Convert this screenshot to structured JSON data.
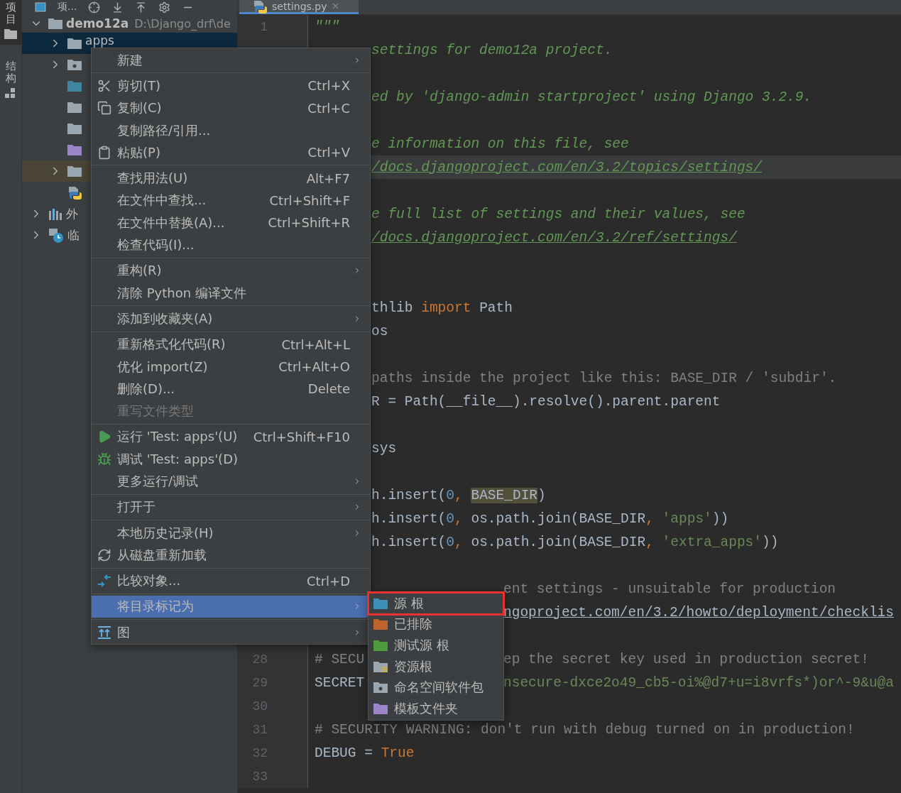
{
  "side_strip": {
    "tabs": [
      {
        "label": "项目",
        "selected": true
      },
      {
        "label": "结构",
        "selected": false
      }
    ]
  },
  "project_panel": {
    "toolbar": {
      "title": "项..."
    },
    "tree": [
      {
        "label": "demo12a",
        "path": "D:\\Django_drf\\de",
        "kind": "folder",
        "color": "#9aa7b0",
        "expanded": true,
        "selected": false,
        "highlighted": false,
        "children": [
          {
            "label": "apps",
            "kind": "folder",
            "color": "#9aa7b0",
            "expanded": false,
            "selected": true,
            "highlighted": false
          },
          {
            "kind": "namespace",
            "color": "#9aa7b0",
            "expanded": false,
            "selected": false,
            "highlighted": false
          },
          {
            "kind": "leaf_folder",
            "color": "#3e86a0",
            "selected": false,
            "highlighted": false
          },
          {
            "kind": "leaf_folder",
            "color": "#9aa7b0",
            "selected": false,
            "highlighted": false
          },
          {
            "kind": "leaf_folder",
            "color": "#9aa7b0",
            "selected": false,
            "highlighted": false
          },
          {
            "kind": "leaf_folder",
            "color": "#9b84c8",
            "selected": false,
            "highlighted": false
          },
          {
            "kind": "folder",
            "color": "#9aa7b0",
            "expanded": false,
            "selected": false,
            "highlighted": true
          },
          {
            "kind": "python_file",
            "selected": false,
            "highlighted": false
          }
        ]
      },
      {
        "label": "外",
        "kind": "library",
        "expanded": false,
        "selected": false,
        "highlighted": false
      },
      {
        "label": "临",
        "kind": "scratch",
        "expanded": false,
        "selected": false,
        "highlighted": false
      }
    ]
  },
  "editor": {
    "tab": {
      "label": "settings.py",
      "selected": true
    },
    "lines": [
      {
        "number": "1",
        "kind": "full",
        "parts": [
          {
            "text": "\"\"\"",
            "kind": "doc"
          }
        ]
      },
      {
        "kind": "after_menu",
        "parts": [
          {
            "text": "settings for demo12a project.",
            "kind": "doc"
          }
        ]
      },
      {
        "kind": "blank"
      },
      {
        "kind": "after_menu",
        "parts": [
          {
            "text": "ed by 'django-admin startproject' using Django 3.2.9.",
            "kind": "doc"
          }
        ]
      },
      {
        "kind": "blank"
      },
      {
        "kind": "after_menu",
        "parts": [
          {
            "text": "e information on this file, see",
            "kind": "doc"
          }
        ]
      },
      {
        "kind": "after_menu",
        "current": true,
        "parts": [
          {
            "text": "/docs.djangoproject.com/en/3.2/topics/settings/",
            "kind": "link"
          }
        ]
      },
      {
        "kind": "blank"
      },
      {
        "kind": "after_menu",
        "parts": [
          {
            "text": "e full list of settings and their values, see",
            "kind": "doc"
          }
        ]
      },
      {
        "kind": "after_menu",
        "parts": [
          {
            "text": "/docs.djangoproject.com/en/3.2/ref/settings/",
            "kind": "link"
          }
        ]
      },
      {
        "kind": "blank"
      },
      {
        "kind": "blank"
      },
      {
        "kind": "after_menu",
        "parts": [
          {
            "text": "thlib ",
            "kind": "plain"
          },
          {
            "text": "import",
            "kind": "keyword"
          },
          {
            "text": " Path",
            "kind": "plain"
          }
        ]
      },
      {
        "kind": "after_menu",
        "parts": [
          {
            "text": "os",
            "kind": "plain"
          }
        ]
      },
      {
        "kind": "blank"
      },
      {
        "kind": "after_menu",
        "parts": [
          {
            "text": "paths inside the project like this: BASE_DIR / 'subdir'.",
            "kind": "comment"
          }
        ]
      },
      {
        "kind": "after_menu",
        "parts": [
          {
            "text": "R = Path(__file__).resolve().parent.parent",
            "kind": "plain"
          }
        ]
      },
      {
        "kind": "blank"
      },
      {
        "kind": "after_menu",
        "parts": [
          {
            "text": "sys",
            "kind": "plain"
          }
        ]
      },
      {
        "kind": "blank"
      },
      {
        "kind": "after_menu",
        "parts": [
          {
            "text": "h.insert(",
            "kind": "plain"
          },
          {
            "text": "0",
            "kind": "number"
          },
          {
            "text": ", ",
            "kind": "punct"
          },
          {
            "text": "BASE_DIR",
            "kind": "usage"
          },
          {
            "text": ")",
            "kind": "plain"
          }
        ]
      },
      {
        "kind": "after_menu",
        "parts": [
          {
            "text": "h.insert(",
            "kind": "plain"
          },
          {
            "text": "0",
            "kind": "number"
          },
          {
            "text": ", ",
            "kind": "punct"
          },
          {
            "text": "os.path.join(BASE_DIR",
            "kind": "plain"
          },
          {
            "text": ", ",
            "kind": "punct"
          },
          {
            "text": "'apps'",
            "kind": "string"
          },
          {
            "text": "))",
            "kind": "plain"
          }
        ]
      },
      {
        "kind": "after_menu",
        "parts": [
          {
            "text": "h.insert(",
            "kind": "plain"
          },
          {
            "text": "0",
            "kind": "number"
          },
          {
            "text": ", ",
            "kind": "punct"
          },
          {
            "text": "os.path.join(BASE_DIR",
            "kind": "plain"
          },
          {
            "text": ", ",
            "kind": "punct"
          },
          {
            "text": "'extra_apps'",
            "kind": "string"
          },
          {
            "text": "))",
            "kind": "plain"
          }
        ]
      },
      {
        "kind": "blank"
      },
      {
        "kind": "after_submenu",
        "parts": [
          {
            "text": "ent settings - unsuitable for production",
            "kind": "comment"
          }
        ]
      },
      {
        "kind": "after_submenu",
        "parts": [
          {
            "text": "ngoproject.com/en/3.2/howto/deployment/checklis",
            "kind": "link_plain"
          }
        ]
      },
      {
        "kind": "blank"
      },
      {
        "number": "28",
        "kind": "split",
        "parts": [
          {
            "text": "# SECU",
            "kind": "comment"
          }
        ],
        "right_parts": [
          {
            "text": "ep the secret key used in production secret!",
            "kind": "comment"
          }
        ]
      },
      {
        "number": "29",
        "kind": "split",
        "parts": [
          {
            "text": "SECRET",
            "kind": "plain"
          }
        ],
        "right_parts": [
          {
            "text": "nsecure-dxce2o49_cb5-oi%@d7+u=i8vrfs*)or^-9&u@a",
            "kind": "string"
          }
        ]
      },
      {
        "number": "30",
        "kind": "full"
      },
      {
        "number": "31",
        "kind": "full",
        "parts": [
          {
            "text": "# SECURITY WARNING: don't run with debug turned on in production!",
            "kind": "comment"
          }
        ]
      },
      {
        "number": "32",
        "kind": "full",
        "parts": [
          {
            "text": "DEBUG = ",
            "kind": "plain"
          },
          {
            "text": "True",
            "kind": "keyword"
          }
        ]
      },
      {
        "number": "33",
        "kind": "full"
      }
    ]
  },
  "context_menu": {
    "groups": [
      [
        {
          "label": "新建",
          "has_submenu": true,
          "disabled": false,
          "selected": false
        }
      ],
      [
        {
          "label": "剪切(T)",
          "shortcut": "Ctrl+X",
          "has_submenu": false,
          "disabled": false,
          "selected": false
        },
        {
          "label": "复制(C)",
          "shortcut": "Ctrl+C",
          "has_submenu": false,
          "disabled": false,
          "selected": false
        },
        {
          "label": "复制路径/引用...",
          "has_submenu": false,
          "disabled": false,
          "selected": false
        },
        {
          "label": "粘贴(P)",
          "shortcut": "Ctrl+V",
          "has_submenu": false,
          "disabled": false,
          "selected": false
        }
      ],
      [
        {
          "label": "查找用法(U)",
          "shortcut": "Alt+F7",
          "has_submenu": false,
          "disabled": false,
          "selected": false
        },
        {
          "label": "在文件中查找...",
          "shortcut": "Ctrl+Shift+F",
          "has_submenu": false,
          "disabled": false,
          "selected": false
        },
        {
          "label": "在文件中替换(A)...",
          "shortcut": "Ctrl+Shift+R",
          "has_submenu": false,
          "disabled": false,
          "selected": false
        },
        {
          "label": "检查代码(I)...",
          "has_submenu": false,
          "disabled": false,
          "selected": false
        }
      ],
      [
        {
          "label": "重构(R)",
          "has_submenu": true,
          "disabled": false,
          "selected": false
        },
        {
          "label": "清除 Python 编译文件",
          "has_submenu": false,
          "disabled": false,
          "selected": false
        }
      ],
      [
        {
          "label": "添加到收藏夹(A)",
          "has_submenu": true,
          "disabled": false,
          "selected": false
        }
      ],
      [
        {
          "label": "重新格式化代码(R)",
          "shortcut": "Ctrl+Alt+L",
          "has_submenu": false,
          "disabled": false,
          "selected": false
        },
        {
          "label": "优化 import(Z)",
          "shortcut": "Ctrl+Alt+O",
          "has_submenu": false,
          "disabled": false,
          "selected": false
        },
        {
          "label": "删除(D)...",
          "shortcut": "Delete",
          "has_submenu": false,
          "disabled": false,
          "selected": false
        },
        {
          "label": "重写文件类型",
          "has_submenu": false,
          "disabled": true,
          "selected": false
        }
      ],
      [
        {
          "label": "运行 'Test: apps'(U)",
          "shortcut": "Ctrl+Shift+F10",
          "has_submenu": false,
          "disabled": false,
          "selected": false
        },
        {
          "label": "调试 'Test: apps'(D)",
          "has_submenu": false,
          "disabled": false,
          "selected": false
        },
        {
          "label": "更多运行/调试",
          "has_submenu": true,
          "disabled": false,
          "selected": false
        }
      ],
      [
        {
          "label": "打开于",
          "has_submenu": true,
          "disabled": false,
          "selected": false
        }
      ],
      [
        {
          "label": "本地历史记录(H)",
          "has_submenu": true,
          "disabled": false,
          "selected": false
        },
        {
          "label": "从磁盘重新加载",
          "has_submenu": false,
          "disabled": false,
          "selected": false
        }
      ],
      [
        {
          "label": "比较对象...",
          "shortcut": "Ctrl+D",
          "has_submenu": false,
          "disabled": false,
          "selected": false
        }
      ],
      [
        {
          "label": "将目录标记为",
          "has_submenu": true,
          "disabled": false,
          "selected": true
        }
      ],
      [
        {
          "label": "图",
          "has_submenu": true,
          "disabled": false,
          "selected": false
        }
      ]
    ]
  },
  "submenu": {
    "items": [
      {
        "label": "源 根",
        "kind": "plain",
        "color": "#3d8fb5",
        "selected": true
      },
      {
        "label": "已排除",
        "kind": "plain",
        "color": "#c0622b",
        "selected": false
      },
      {
        "label": "测试源 根",
        "kind": "plain",
        "color": "#4e9a3f",
        "selected": false
      },
      {
        "label": "资源根",
        "kind": "resource",
        "color": "#9aa7b0",
        "selected": false
      },
      {
        "label": "命名空间软件包",
        "kind": "namespace",
        "color": "#9aa7b0",
        "selected": false
      },
      {
        "label": "模板文件夹",
        "kind": "plain",
        "color": "#9b84c8",
        "selected": false
      }
    ]
  }
}
